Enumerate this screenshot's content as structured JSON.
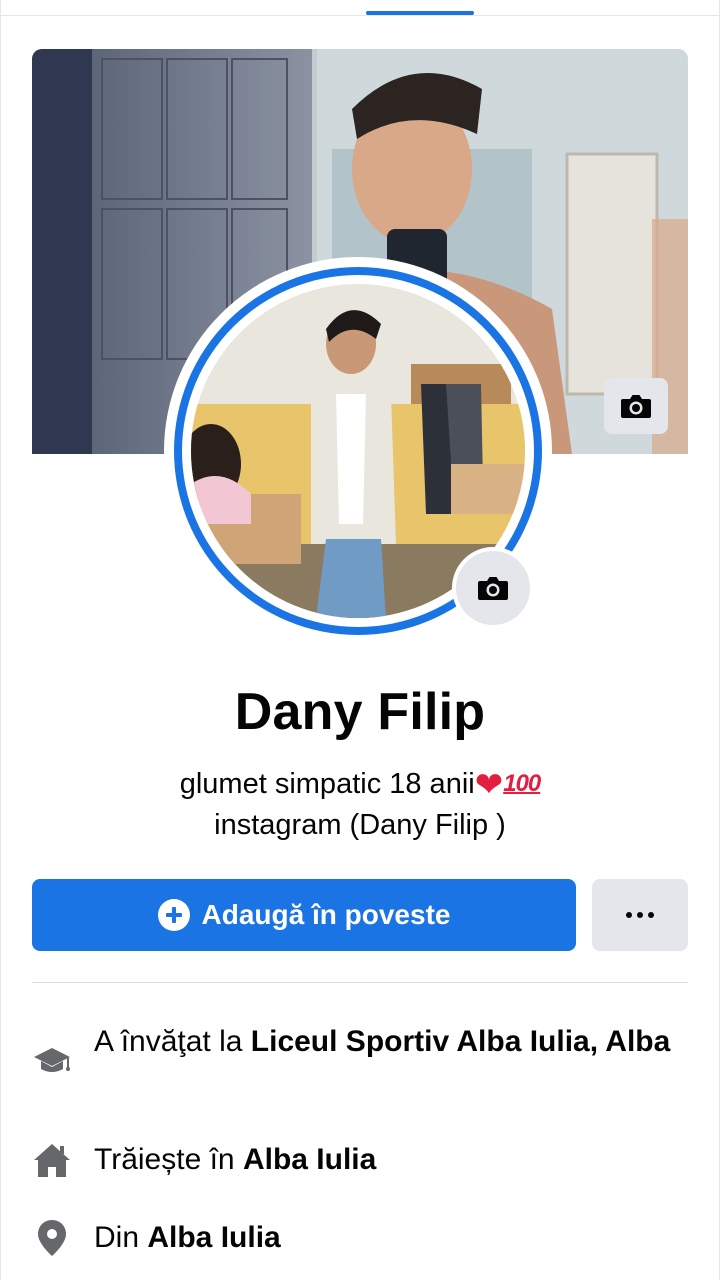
{
  "profile": {
    "name": "Dany Filip",
    "bio_line1": "glumet simpatic 18 anii",
    "bio_emoji_heart": "❤",
    "bio_emoji_100": "100",
    "bio_line2": "instagram (Dany Filip )"
  },
  "actions": {
    "add_story_label": "Adaugă în poveste"
  },
  "intro": {
    "education_prefix": "A învăţat la ",
    "education_place": "Liceul Sportiv Alba Iulia, Alba",
    "lives_prefix": "Trăiește în ",
    "lives_place": "Alba Iulia",
    "from_prefix": "Din ",
    "from_place": "Alba Iulia"
  },
  "colors": {
    "accent": "#1b74e4",
    "button_secondary": "#e4e6eb",
    "text": "#050505",
    "icon_gray": "#65676b"
  },
  "icons": {
    "cover_camera": "camera-icon",
    "avatar_camera": "camera-icon",
    "add_story": "plus-circle-icon",
    "more": "more-dots-icon",
    "education": "graduation-cap-icon",
    "lives": "home-icon",
    "from": "location-pin-icon"
  }
}
